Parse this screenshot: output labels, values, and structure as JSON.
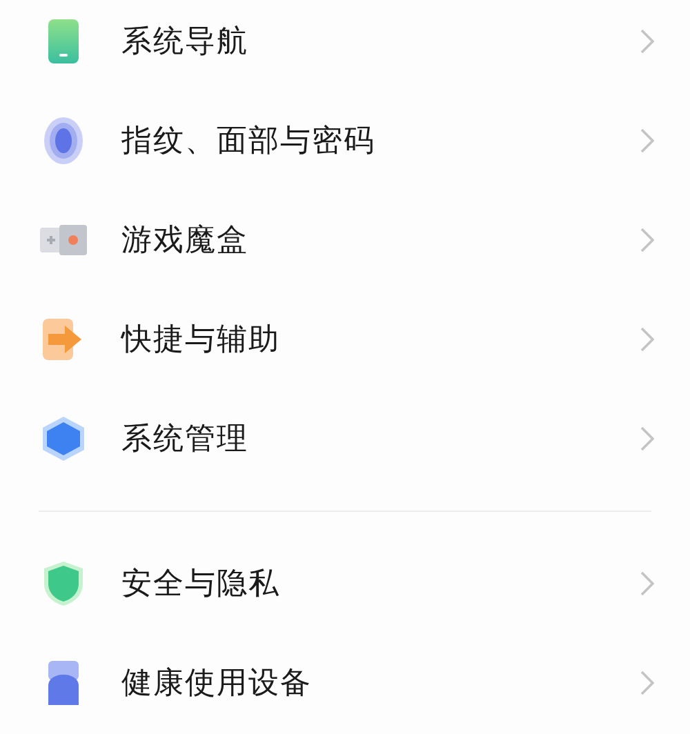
{
  "groups": [
    {
      "items": [
        {
          "kind": "phone",
          "label": "系统导航"
        },
        {
          "kind": "oval",
          "label": "指纹、面部与密码"
        },
        {
          "kind": "gamebox",
          "label": "游戏魔盒"
        },
        {
          "kind": "arrow",
          "label": "快捷与辅助"
        },
        {
          "kind": "hexagon",
          "label": "系统管理"
        }
      ]
    },
    {
      "items": [
        {
          "kind": "shield",
          "label": "安全与隐私"
        },
        {
          "kind": "device",
          "label": "健康使用设备"
        }
      ]
    }
  ]
}
